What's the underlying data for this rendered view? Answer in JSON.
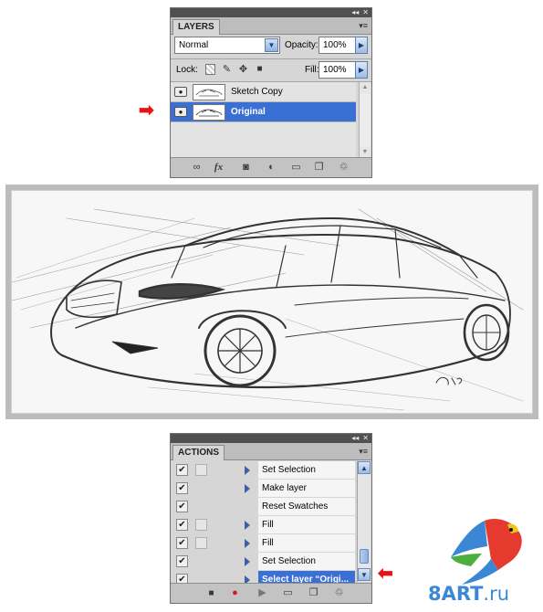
{
  "layers_panel": {
    "tab": "LAYERS",
    "topbar_collapse": "◂◂",
    "topbar_close": "✕",
    "menu": "▾≡",
    "blend_mode": "Normal",
    "opacity_label": "Opacity:",
    "opacity_value": "100%",
    "lock_label": "Lock:",
    "fill_label": "Fill:",
    "fill_value": "100%",
    "layers": [
      {
        "name": "Sketch Copy",
        "selected": false
      },
      {
        "name": "Original",
        "selected": true
      }
    ],
    "bottom_icons": [
      "link-icon",
      "fx-icon",
      "mask-icon",
      "adjustment-icon",
      "folder-icon",
      "new-layer-icon",
      "trash-icon"
    ]
  },
  "arrows": {
    "glyph": "➡"
  },
  "actions_panel": {
    "tab": "ACTIONS",
    "topbar_collapse": "◂◂",
    "topbar_close": "✕",
    "menu": "▾≡",
    "items": [
      {
        "label": "Set Selection",
        "checked": true,
        "dialog": true,
        "expand": true
      },
      {
        "label": "Make layer",
        "checked": true,
        "dialog": false,
        "expand": true
      },
      {
        "label": "Reset Swatches",
        "checked": true,
        "dialog": false,
        "expand": false
      },
      {
        "label": "Fill",
        "checked": true,
        "dialog": true,
        "expand": true
      },
      {
        "label": "Fill",
        "checked": true,
        "dialog": true,
        "expand": true
      },
      {
        "label": "Set Selection",
        "checked": true,
        "dialog": false,
        "expand": true
      },
      {
        "label": "Select layer “Origi...",
        "checked": true,
        "dialog": false,
        "expand": true,
        "selected": true
      }
    ],
    "bottom_icons": [
      "stop-icon",
      "record-icon",
      "play-icon",
      "folder-icon",
      "new-action-icon",
      "trash-icon"
    ]
  },
  "watermark": {
    "brand": "8ART",
    "tld": ".ru",
    "brand_colors": [
      "#3b87d6",
      "#e43b2e",
      "#4cae3c",
      "#f0c419"
    ]
  }
}
